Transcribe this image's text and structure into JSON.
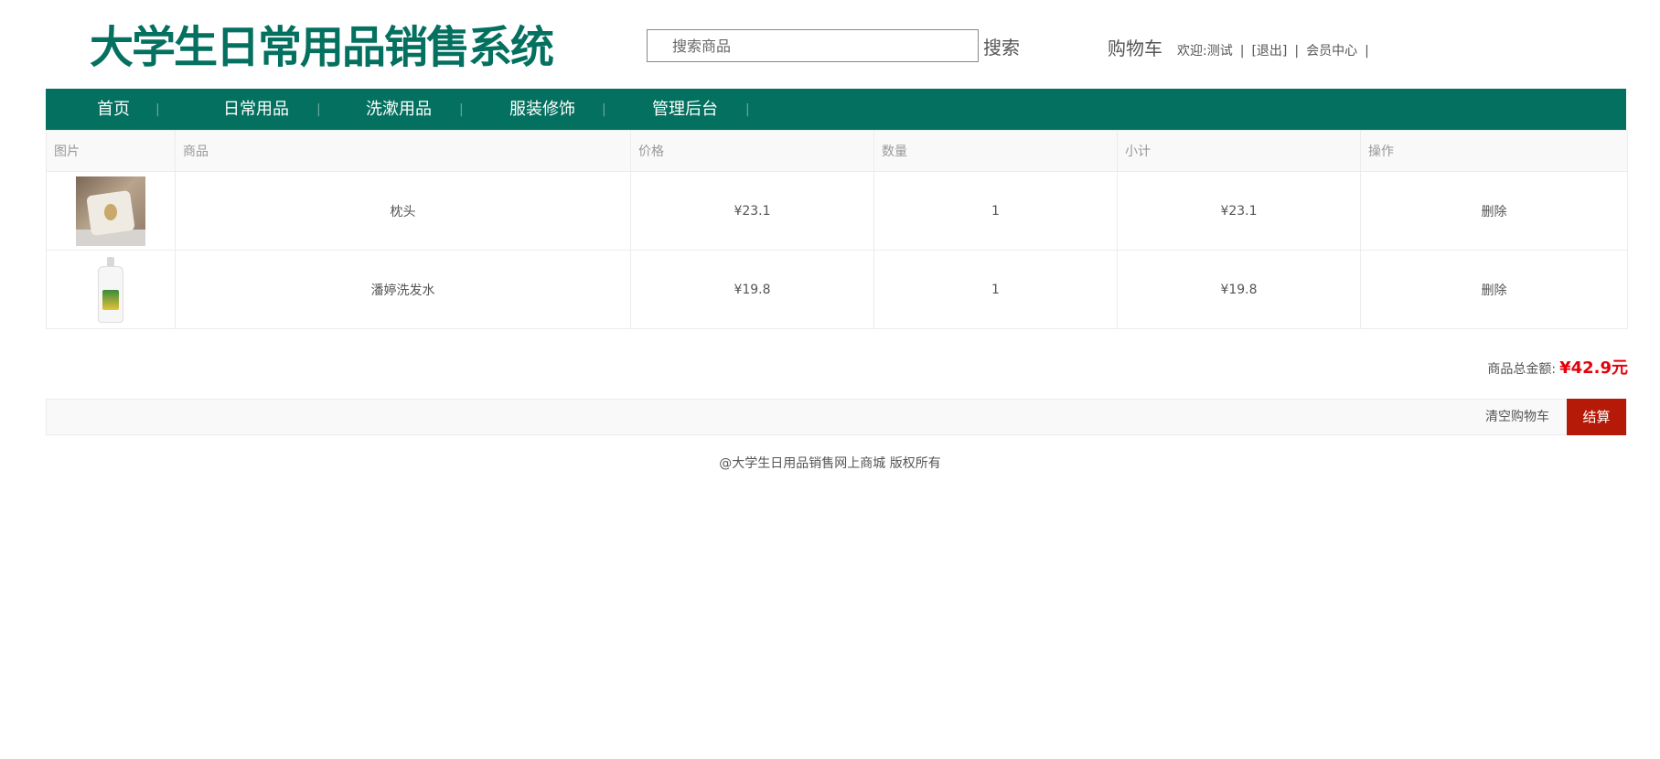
{
  "header": {
    "logo_text": "大学生日常用品销售系统",
    "search_placeholder": "搜索商品",
    "search_button": "搜索",
    "cart_link": "购物车",
    "welcome": "欢迎:测试",
    "logout": "[退出]",
    "member_center": "会员中心",
    "divider": "|"
  },
  "nav": {
    "items": [
      {
        "label": "首页"
      },
      {
        "label": "日常用品"
      },
      {
        "label": "洗漱用品"
      },
      {
        "label": "服装修饰"
      },
      {
        "label": "管理后台"
      }
    ],
    "separator": "|"
  },
  "cart": {
    "columns": [
      "图片",
      "商品",
      "价格",
      "数量",
      "小计",
      "操作"
    ],
    "rows": [
      {
        "image": "pillow-image",
        "name": "枕头",
        "price": "¥23.1",
        "quantity": "1",
        "subtotal": "¥23.1",
        "action": "删除"
      },
      {
        "image": "shampoo-image",
        "name": "潘婷洗发水",
        "price": "¥19.8",
        "quantity": "1",
        "subtotal": "¥19.8",
        "action": "删除"
      }
    ]
  },
  "summary": {
    "total_label": "商品总金额:",
    "total_value": "¥42.9元"
  },
  "actions": {
    "clear_cart": "清空购物车",
    "checkout": "结算"
  },
  "footer": {
    "copyright": "@大学生日用品销售网上商城 版权所有"
  },
  "colors": {
    "brand_green": "#04705f",
    "checkout_red": "#b51a09",
    "total_red": "#e4000c"
  }
}
